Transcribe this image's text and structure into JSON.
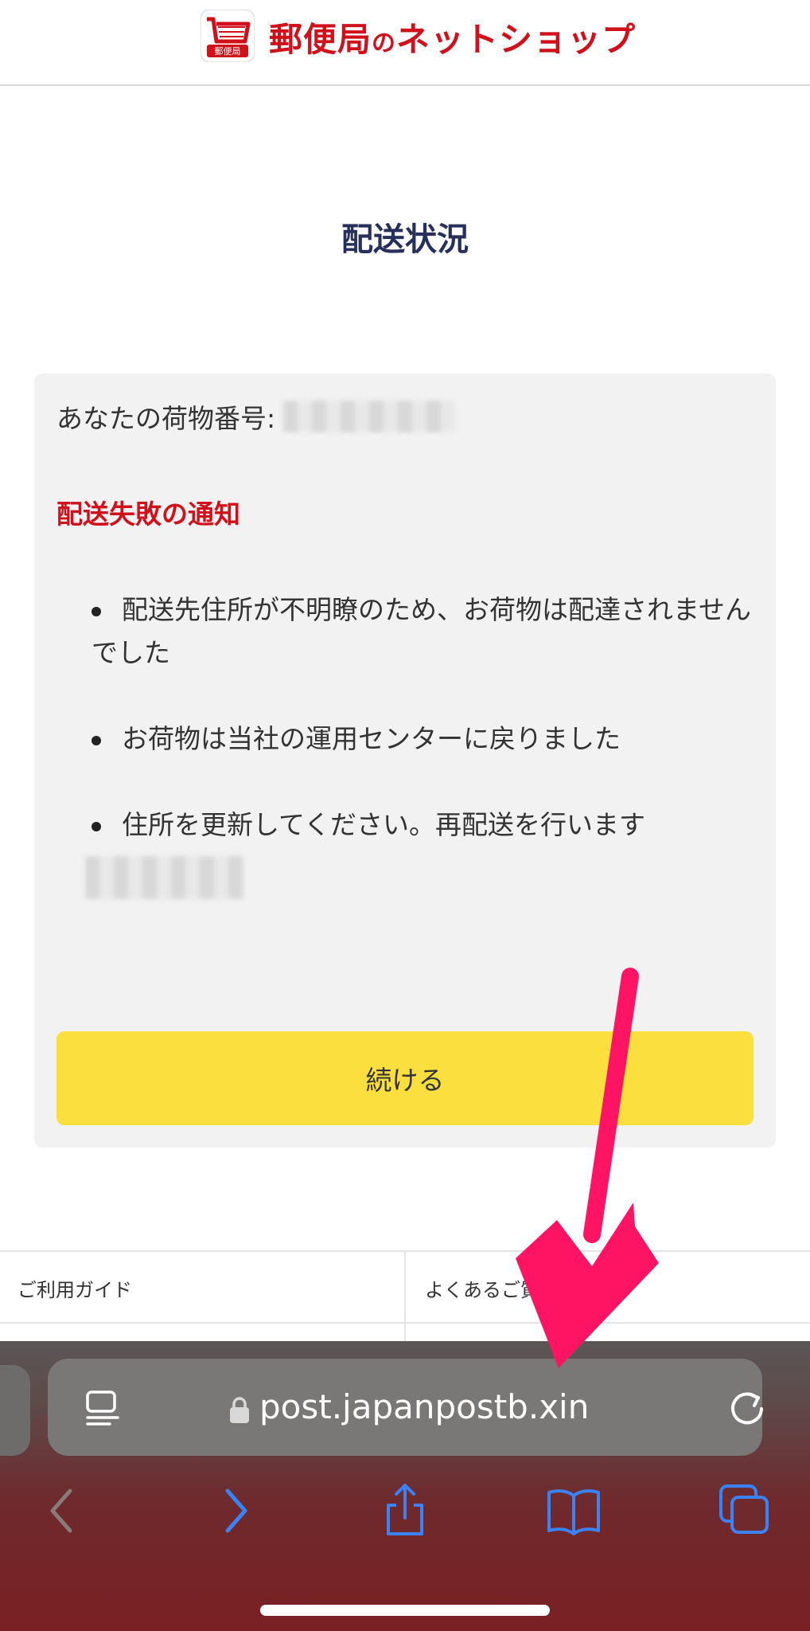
{
  "header": {
    "logo_badge": "郵便局",
    "brand_main": "郵便局",
    "brand_small": "の",
    "brand_tail": "ネットショップ"
  },
  "page": {
    "title": "配送状況"
  },
  "card": {
    "tracking_label": "あなたの荷物番号:",
    "failure_heading": "配送失敗の通知",
    "items": [
      "配送先住所が不明瞭のため、お荷物は配達されませんでした",
      "お荷物は当社の運用センターに戻りました",
      "住所を更新してください。再配送を行います"
    ],
    "continue_label": "続ける"
  },
  "footer": {
    "link_guide": "ご利用ガイド",
    "link_faq": "よくあるご質"
  },
  "browser": {
    "url": "post.japanpostb.xin"
  },
  "colors": {
    "brand_red": "#d0101b",
    "title_navy": "#27305a",
    "button_yellow": "#fbdf3e",
    "arrow_pink": "#ff1463",
    "ios_blue": "#3b82f6"
  },
  "icons": {
    "logo": "shopping-cart-icon",
    "reader": "reader-mode-icon",
    "lock": "lock-icon",
    "reload": "reload-icon",
    "back": "back-chevron-icon",
    "forward": "forward-chevron-icon",
    "share": "share-icon",
    "bookmarks": "bookmarks-icon",
    "tabs": "tabs-icon"
  }
}
